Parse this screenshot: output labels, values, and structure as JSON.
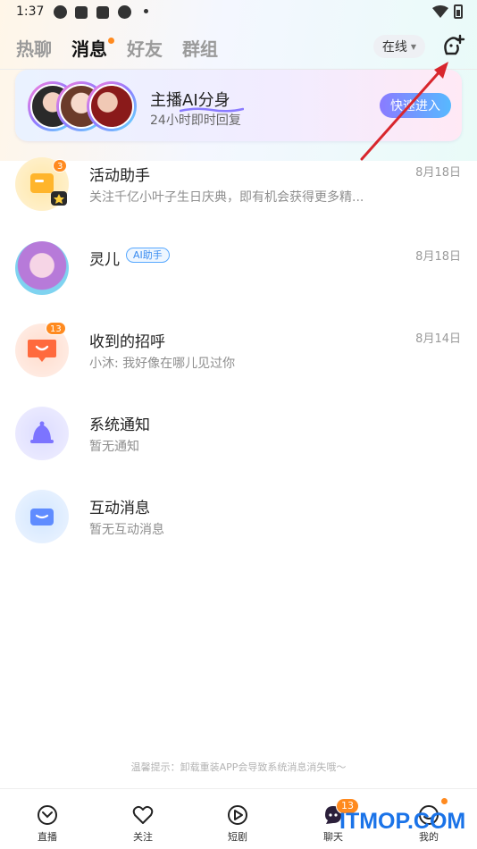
{
  "status_bar": {
    "time": "1:37"
  },
  "header": {
    "tabs": [
      {
        "label": "热聊",
        "active": false
      },
      {
        "label": "消息",
        "active": true,
        "dot": true
      },
      {
        "label": "好友",
        "active": false
      },
      {
        "label": "群组",
        "active": false
      }
    ],
    "online_select": "在线",
    "add_icon": "add-friend-icon"
  },
  "banner": {
    "title": "主播AI分身",
    "subtitle": "24小时即时回复",
    "button_label": "快速进入"
  },
  "messages": [
    {
      "name": "活动助手",
      "badge": "3",
      "date": "8月18日",
      "preview": "关注千亿小叶子生日庆典，即有机会获得更多精..."
    },
    {
      "name": "灵儿",
      "tag": "AI助手",
      "date": "8月18日",
      "preview": ""
    },
    {
      "name": "收到的招呼",
      "badge": "13",
      "date": "8月14日",
      "preview": "小沐: 我好像在哪儿见过你"
    },
    {
      "name": "系统通知",
      "date": "",
      "preview": "暂无通知"
    },
    {
      "name": "互动消息",
      "date": "",
      "preview": "暂无互动消息"
    }
  ],
  "footer_tip": "温馨提示：卸载重装APP会导致系统消息消失哦～",
  "bottom_nav": [
    {
      "label": "直播",
      "icon": "live-icon"
    },
    {
      "label": "关注",
      "icon": "heart-icon"
    },
    {
      "label": "短剧",
      "icon": "play-icon"
    },
    {
      "label": "聊天",
      "icon": "chat-icon",
      "badge": "13"
    },
    {
      "label": "我的",
      "icon": "profile-icon",
      "dot": true
    }
  ],
  "watermark": "ITMOP.COM",
  "colors": {
    "accent": "#ff8a1f",
    "arrow": "#d8262d",
    "link": "#3a8cf0"
  }
}
